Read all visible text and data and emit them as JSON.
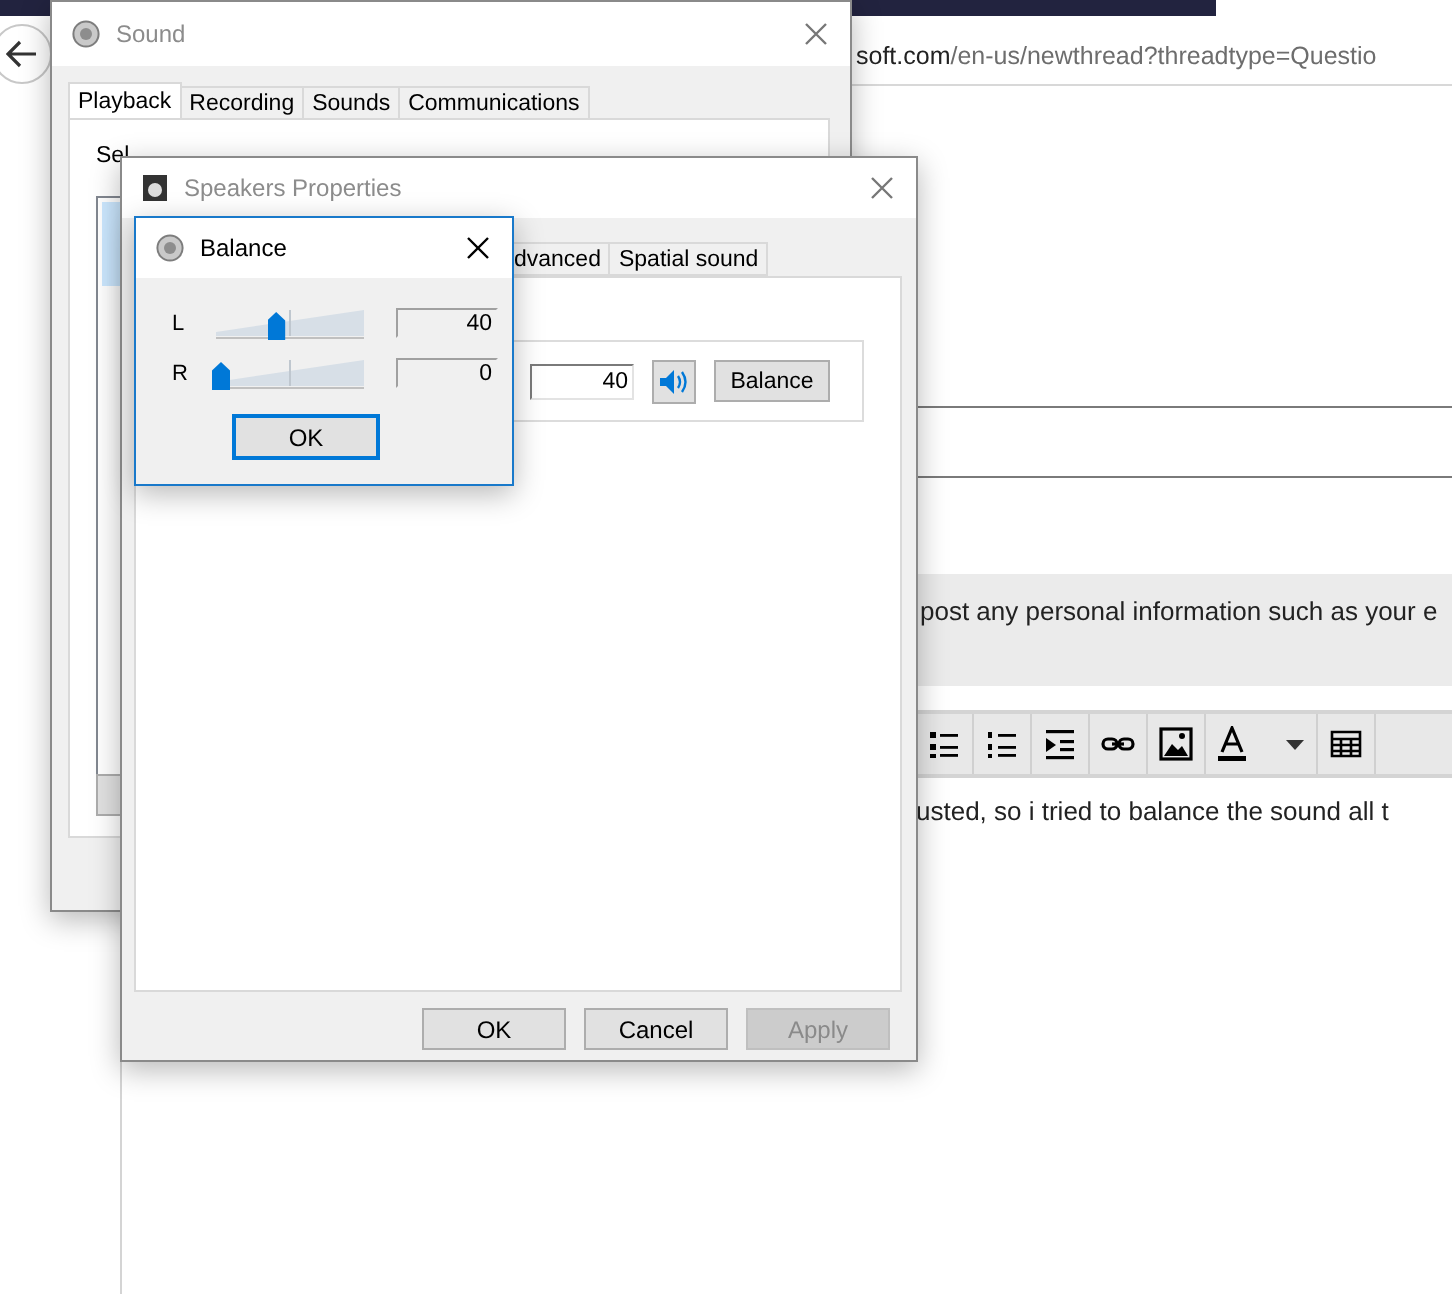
{
  "browser": {
    "url_domain": "soft.com",
    "url_path": "/en-us/newthread?threadtype=Questio",
    "notice": "post any personal information such as your e",
    "body_text": "usted, so i tried to balance the sound all t"
  },
  "sound_window": {
    "title": "Sound",
    "instruction": "Sel",
    "tabs": [
      {
        "label": "Playback",
        "selected": true
      },
      {
        "label": "Recording",
        "selected": false
      },
      {
        "label": "Sounds",
        "selected": false
      },
      {
        "label": "Communications",
        "selected": false
      }
    ]
  },
  "speakers_window": {
    "title": "Speakers Properties",
    "tabs": [
      {
        "label": "dvanced",
        "selected": false
      },
      {
        "label": "Spatial sound",
        "selected": false
      }
    ],
    "volume": "40",
    "balance_button": "Balance",
    "buttons": [
      {
        "label": "OK",
        "disabled": false
      },
      {
        "label": "Cancel",
        "disabled": false
      },
      {
        "label": "Apply",
        "disabled": true
      }
    ]
  },
  "balance_dialog": {
    "title": "Balance",
    "channels": [
      {
        "label": "L",
        "level": 0.4,
        "reading": "40"
      },
      {
        "label": "R",
        "level": 0,
        "reading": "0"
      }
    ],
    "button": "OK"
  }
}
